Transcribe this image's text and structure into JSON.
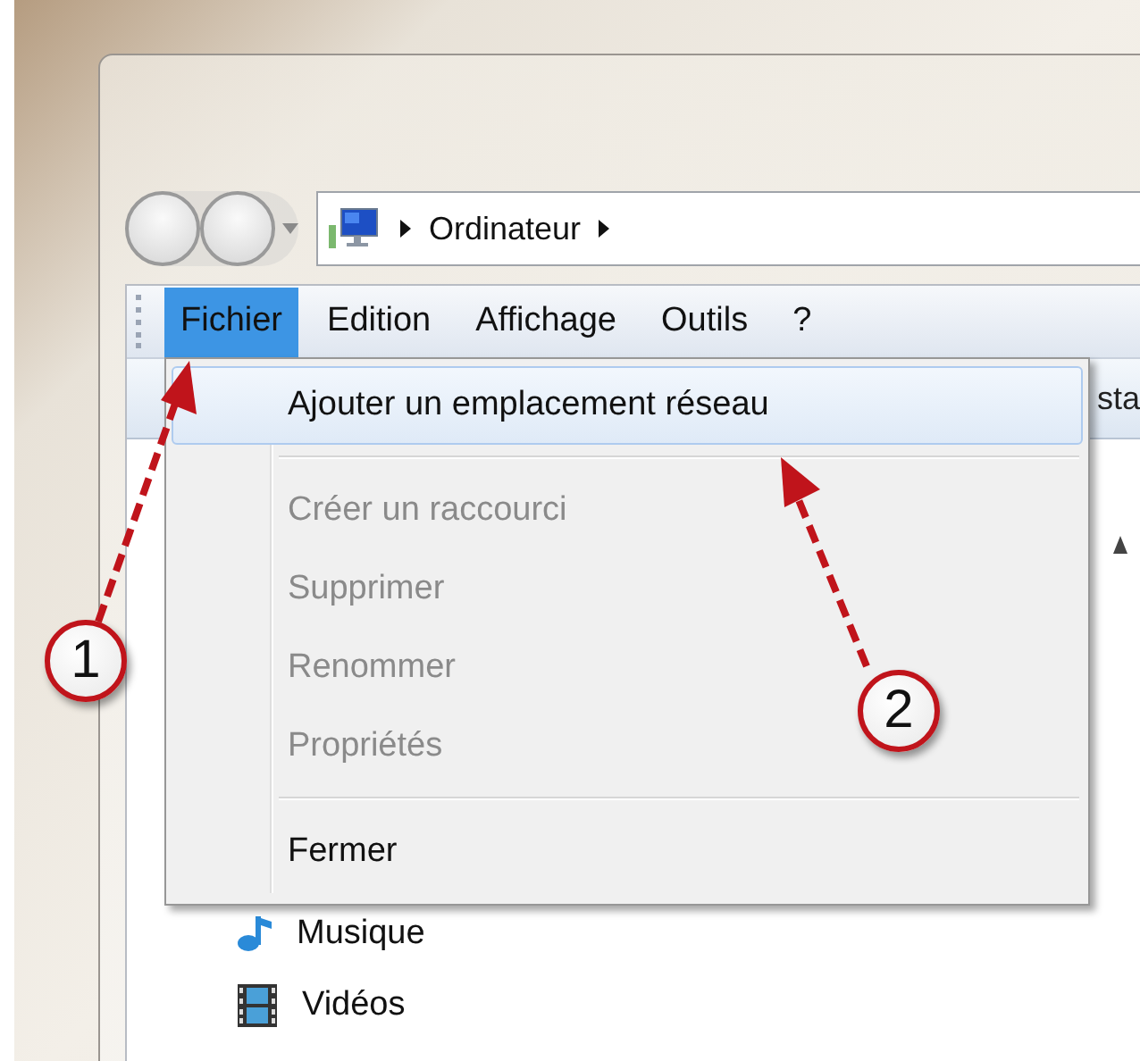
{
  "address_bar": {
    "path": [
      {
        "label": "Ordinateur"
      }
    ]
  },
  "menu_bar": [
    {
      "label": "Fichier",
      "selected": true
    },
    {
      "label": "Edition",
      "selected": false
    },
    {
      "label": "Affichage",
      "selected": false
    },
    {
      "label": "Outils",
      "selected": false
    },
    {
      "label": "?",
      "selected": false
    }
  ],
  "toolbar": {
    "cut_text": "sta"
  },
  "file_menu": [
    {
      "kind": "item",
      "label": "Ajouter un emplacement réseau",
      "selected": true,
      "disabled": false
    },
    {
      "kind": "separator"
    },
    {
      "kind": "item",
      "label": "Créer un raccourci",
      "selected": false,
      "disabled": true
    },
    {
      "kind": "item",
      "label": "Supprimer",
      "selected": false,
      "disabled": true
    },
    {
      "kind": "item",
      "label": "Renommer",
      "selected": false,
      "disabled": true
    },
    {
      "kind": "item",
      "label": "Propriétés",
      "selected": false,
      "disabled": true
    },
    {
      "kind": "separator"
    },
    {
      "kind": "item",
      "label": "Fermer",
      "selected": false,
      "disabled": false
    }
  ],
  "navigation_pane": [
    {
      "label": "Musique",
      "kind": "music"
    },
    {
      "label": "Vidéos",
      "kind": "video"
    }
  ],
  "callouts": [
    {
      "number": "1"
    },
    {
      "number": "2"
    }
  ]
}
